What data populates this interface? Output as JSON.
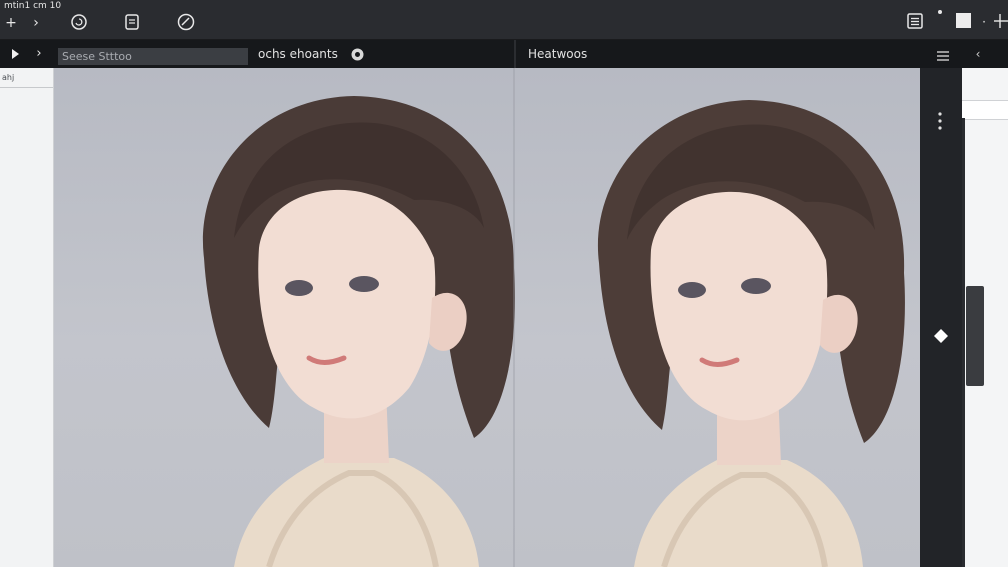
{
  "window": {
    "title": "mtin1 cm 10"
  },
  "toolbar": {
    "icons": [
      "add-icon",
      "forward-icon",
      "circle-arrow-icon",
      "clipboard-icon",
      "edit-circle-icon",
      "list-icon",
      "dot-icon",
      "square-icon",
      "more-icon",
      "crosshair-icon"
    ]
  },
  "subbar": {
    "search_value": "Seese Stttoo",
    "panel_left_label": "ochs ehoants",
    "panel_right_label": "Heatwoos"
  },
  "left_panel": {
    "header": "ahj"
  },
  "canvas": {
    "left_image_alt": "portrait",
    "right_image_alt": "portrait"
  },
  "colors": {
    "topbar": "#2a2c30",
    "subbar": "#16181b",
    "canvas_bg": "#bfc1c8",
    "hair": "#4a3a36",
    "sweater": "#eadccb",
    "skin": "#f2ddd3"
  }
}
